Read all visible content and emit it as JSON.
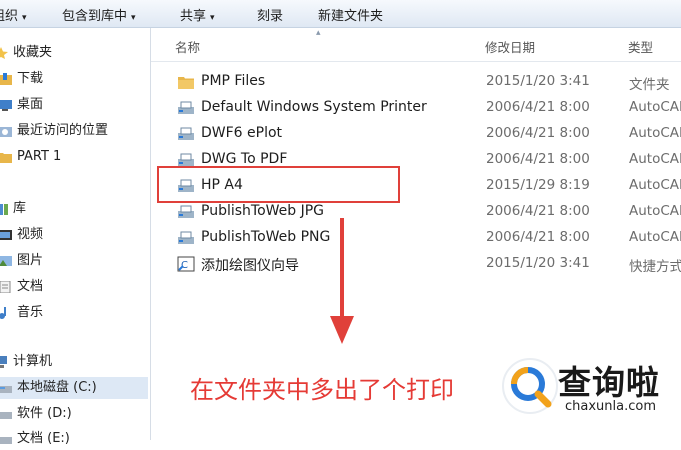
{
  "toolbar": {
    "items": [
      {
        "label": "组织",
        "has_arrow": true
      },
      {
        "label": "包含到库中",
        "has_arrow": true
      },
      {
        "label": "共享",
        "has_arrow": true
      },
      {
        "label": "刻录",
        "has_arrow": false
      },
      {
        "label": "新建文件夹",
        "has_arrow": false
      }
    ],
    "arrow_glyph": "▾"
  },
  "sidebar": {
    "items": [
      {
        "label": "收藏夹",
        "icon": "star-icon"
      },
      {
        "label": "下载",
        "icon": "download-folder-icon"
      },
      {
        "label": "桌面",
        "icon": "desktop-icon"
      },
      {
        "label": "最近访问的位置",
        "icon": "recent-places-icon"
      },
      {
        "label": "PART 1",
        "icon": "folder-icon"
      },
      {
        "label": "库",
        "icon": "library-icon"
      },
      {
        "label": "视频",
        "icon": "video-icon"
      },
      {
        "label": "图片",
        "icon": "pictures-icon"
      },
      {
        "label": "文档",
        "icon": "documents-icon"
      },
      {
        "label": "音乐",
        "icon": "music-icon"
      },
      {
        "label": "计算机",
        "icon": "computer-icon"
      },
      {
        "label": "本地磁盘 (C:)",
        "icon": "drive-icon"
      },
      {
        "label": "软件 (D:)",
        "icon": "drive-icon"
      },
      {
        "label": "文档 (E:)",
        "icon": "drive-icon"
      }
    ]
  },
  "columns": {
    "name": "名称",
    "date": "修改日期",
    "type": "类型"
  },
  "files": [
    {
      "name": "PMP Files",
      "date": "2015/1/20 3:41",
      "type": "文件夹",
      "icon": "folder-icon"
    },
    {
      "name": "Default Windows System Printer",
      "date": "2006/4/21 8:00",
      "type": "AutoCAD",
      "icon": "plotter-icon"
    },
    {
      "name": "DWF6 ePlot",
      "date": "2006/4/21 8:00",
      "type": "AutoCAD",
      "icon": "plotter-icon"
    },
    {
      "name": "DWG To PDF",
      "date": "2006/4/21 8:00",
      "type": "AutoCAD",
      "icon": "plotter-icon"
    },
    {
      "name": "HP A4",
      "date": "2015/1/29 8:19",
      "type": "AutoCAD",
      "icon": "plotter-icon"
    },
    {
      "name": "PublishToWeb JPG",
      "date": "2006/4/21 8:00",
      "type": "AutoCAD",
      "icon": "plotter-icon"
    },
    {
      "name": "PublishToWeb PNG",
      "date": "2006/4/21 8:00",
      "type": "AutoCAD",
      "icon": "plotter-icon"
    },
    {
      "name": "添加绘图仪向导",
      "date": "2015/1/20 3:41",
      "type": "快捷方式",
      "icon": "wizard-shortcut-icon"
    }
  ],
  "annotation": {
    "text": "在文件夹中多出了个打印",
    "color": "#e53a35"
  },
  "watermark": {
    "title": "查询啦",
    "url": "chaxunla.com"
  },
  "colors": {
    "folder": "#e8b64a",
    "highlight_border": "#e0403a",
    "accent_blue": "#2a7ad8"
  }
}
